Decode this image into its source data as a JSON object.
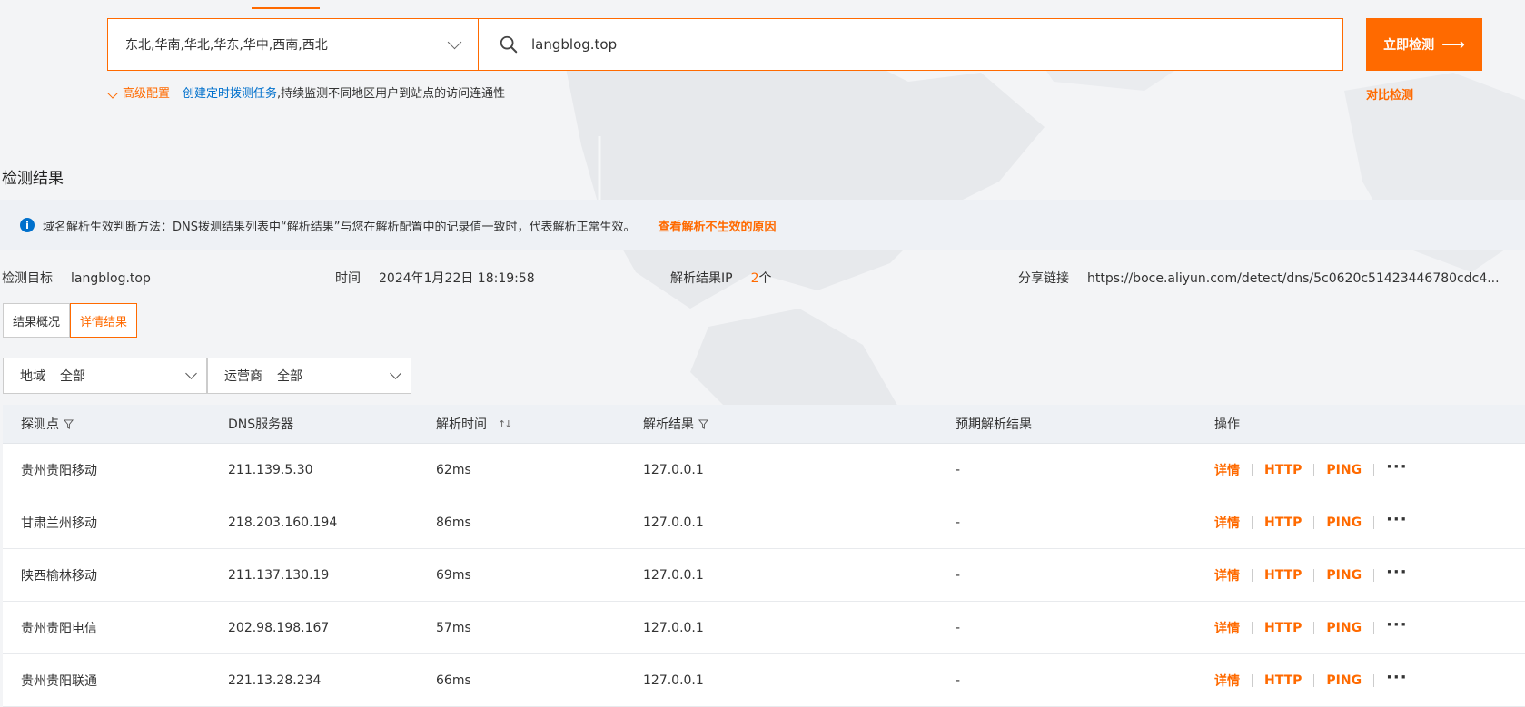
{
  "search": {
    "regions": "东北,华南,华北,华东,华中,西南,西北",
    "domain": "langblog.top",
    "detect_button": "立即检测",
    "advanced_config": "高级配置",
    "create_task_link": "创建定时拨测任务",
    "create_task_suffix": ",持续监测不同地区用户到站点的访问连通性",
    "compare_link": "对比检测"
  },
  "results": {
    "section_title": "检测结果",
    "notice_text": "域名解析生效判断方法：DNS拨测结果列表中“解析结果”与您在解析配置中的记录值一致时，代表解析正常生效。",
    "notice_link": "查看解析不生效的原因",
    "meta": {
      "target_label": "检测目标",
      "target_value": "langblog.top",
      "time_label": "时间",
      "time_value": "2024年1月22日 18:19:58",
      "ip_label": "解析结果IP",
      "ip_count": "2",
      "ip_unit": "个",
      "share_label": "分享链接",
      "share_value": "https://boce.aliyun.com/detect/dns/5c0620c51423446780cdc4..."
    },
    "tabs": [
      "结果概况",
      "详情结果"
    ],
    "active_tab": "详情结果",
    "filters": {
      "region_label": "地域",
      "region_value": "全部",
      "isp_label": "运营商",
      "isp_value": "全部"
    },
    "table": {
      "headers": {
        "probe": "探测点",
        "dns_server": "DNS服务器",
        "resolve_time": "解析时间",
        "resolve_result": "解析结果",
        "expected_result": "预期解析结果",
        "actions": "操作"
      },
      "action_labels": {
        "detail": "详情",
        "http": "HTTP",
        "ping": "PING",
        "more": "···"
      },
      "rows": [
        {
          "probe": "贵州贵阳移动",
          "dns": "211.139.5.30",
          "time": "62ms",
          "result": "127.0.0.1",
          "expected": "-"
        },
        {
          "probe": "甘肃兰州移动",
          "dns": "218.203.160.194",
          "time": "86ms",
          "result": "127.0.0.1",
          "expected": "-"
        },
        {
          "probe": "陕西榆林移动",
          "dns": "211.137.130.19",
          "time": "69ms",
          "result": "127.0.0.1",
          "expected": "-"
        },
        {
          "probe": "贵州贵阳电信",
          "dns": "202.98.198.167",
          "time": "57ms",
          "result": "127.0.0.1",
          "expected": "-"
        },
        {
          "probe": "贵州贵阳联通",
          "dns": "221.13.28.234",
          "time": "66ms",
          "result": "127.0.0.1",
          "expected": "-"
        }
      ]
    }
  },
  "colors": {
    "accent": "#ff6a00",
    "link": "#0070cc",
    "background": "#f3f4f6"
  },
  "icons": [
    "search-icon",
    "chevron-down-icon",
    "info-icon",
    "filter-icon",
    "sort-icon",
    "arrow-right-icon",
    "more-icon"
  ]
}
